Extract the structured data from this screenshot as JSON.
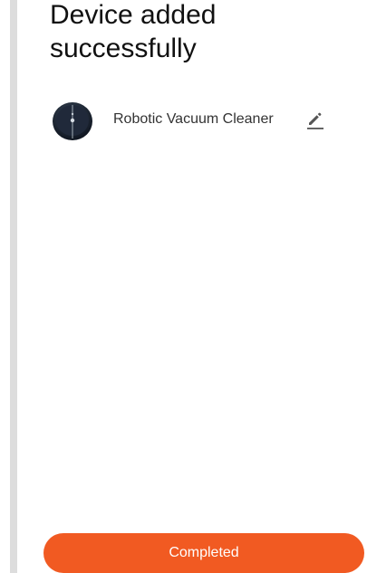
{
  "page": {
    "title": "Device added successfully"
  },
  "device": {
    "name": "Robotic Vacuum Cleaner",
    "image_icon": "robot-vacuum-icon",
    "edit_icon": "pencil-icon"
  },
  "footer": {
    "completed_label": "Completed"
  },
  "colors": {
    "accent": "#f15a22",
    "button_text": "#ffffff"
  }
}
